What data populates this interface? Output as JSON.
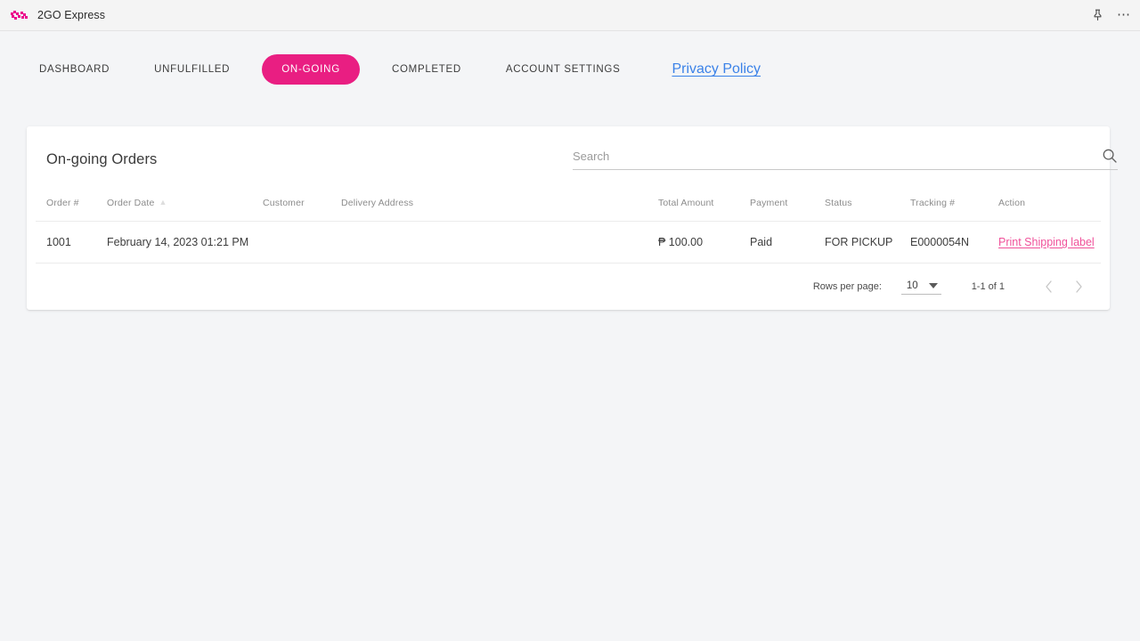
{
  "window": {
    "app_title": "2GO Express",
    "logo_icon": "2go-logo-icon",
    "pin_icon": "pin-icon",
    "more_icon": "more-options-icon"
  },
  "nav": {
    "tabs": [
      {
        "label": "DASHBOARD",
        "active": false
      },
      {
        "label": "UNFULFILLED",
        "active": false
      },
      {
        "label": "ON-GOING",
        "active": true
      },
      {
        "label": "COMPLETED",
        "active": false
      },
      {
        "label": "ACCOUNT SETTINGS",
        "active": false
      }
    ],
    "privacy_link": "Privacy Policy",
    "active_color": "#e91e82",
    "link_color": "#3b82e8"
  },
  "card": {
    "title": "On-going Orders",
    "search": {
      "placeholder": "Search",
      "value": "",
      "icon": "search-icon"
    },
    "table": {
      "headers": [
        "Order #",
        "Order Date",
        "Customer",
        "Delivery Address",
        "Total Amount",
        "Payment",
        "Status",
        "Tracking #",
        "Action"
      ],
      "sort_column": "Order Date",
      "rows": [
        {
          "order_no": "1001",
          "order_date": "February 14, 2023 01:21 PM",
          "customer": "",
          "delivery_address": "",
          "total_amount": "₱ 100.00",
          "payment": "Paid",
          "status": "FOR PICKUP",
          "tracking_no": "E0000054N",
          "action": "Print Shipping label",
          "action_color": "#f0519a"
        }
      ]
    },
    "pagination": {
      "rows_label": "Rows per page:",
      "rows_value": "10",
      "range": "1-1 of 1",
      "prev_icon": "chevron-left-icon",
      "next_icon": "chevron-right-icon"
    }
  }
}
